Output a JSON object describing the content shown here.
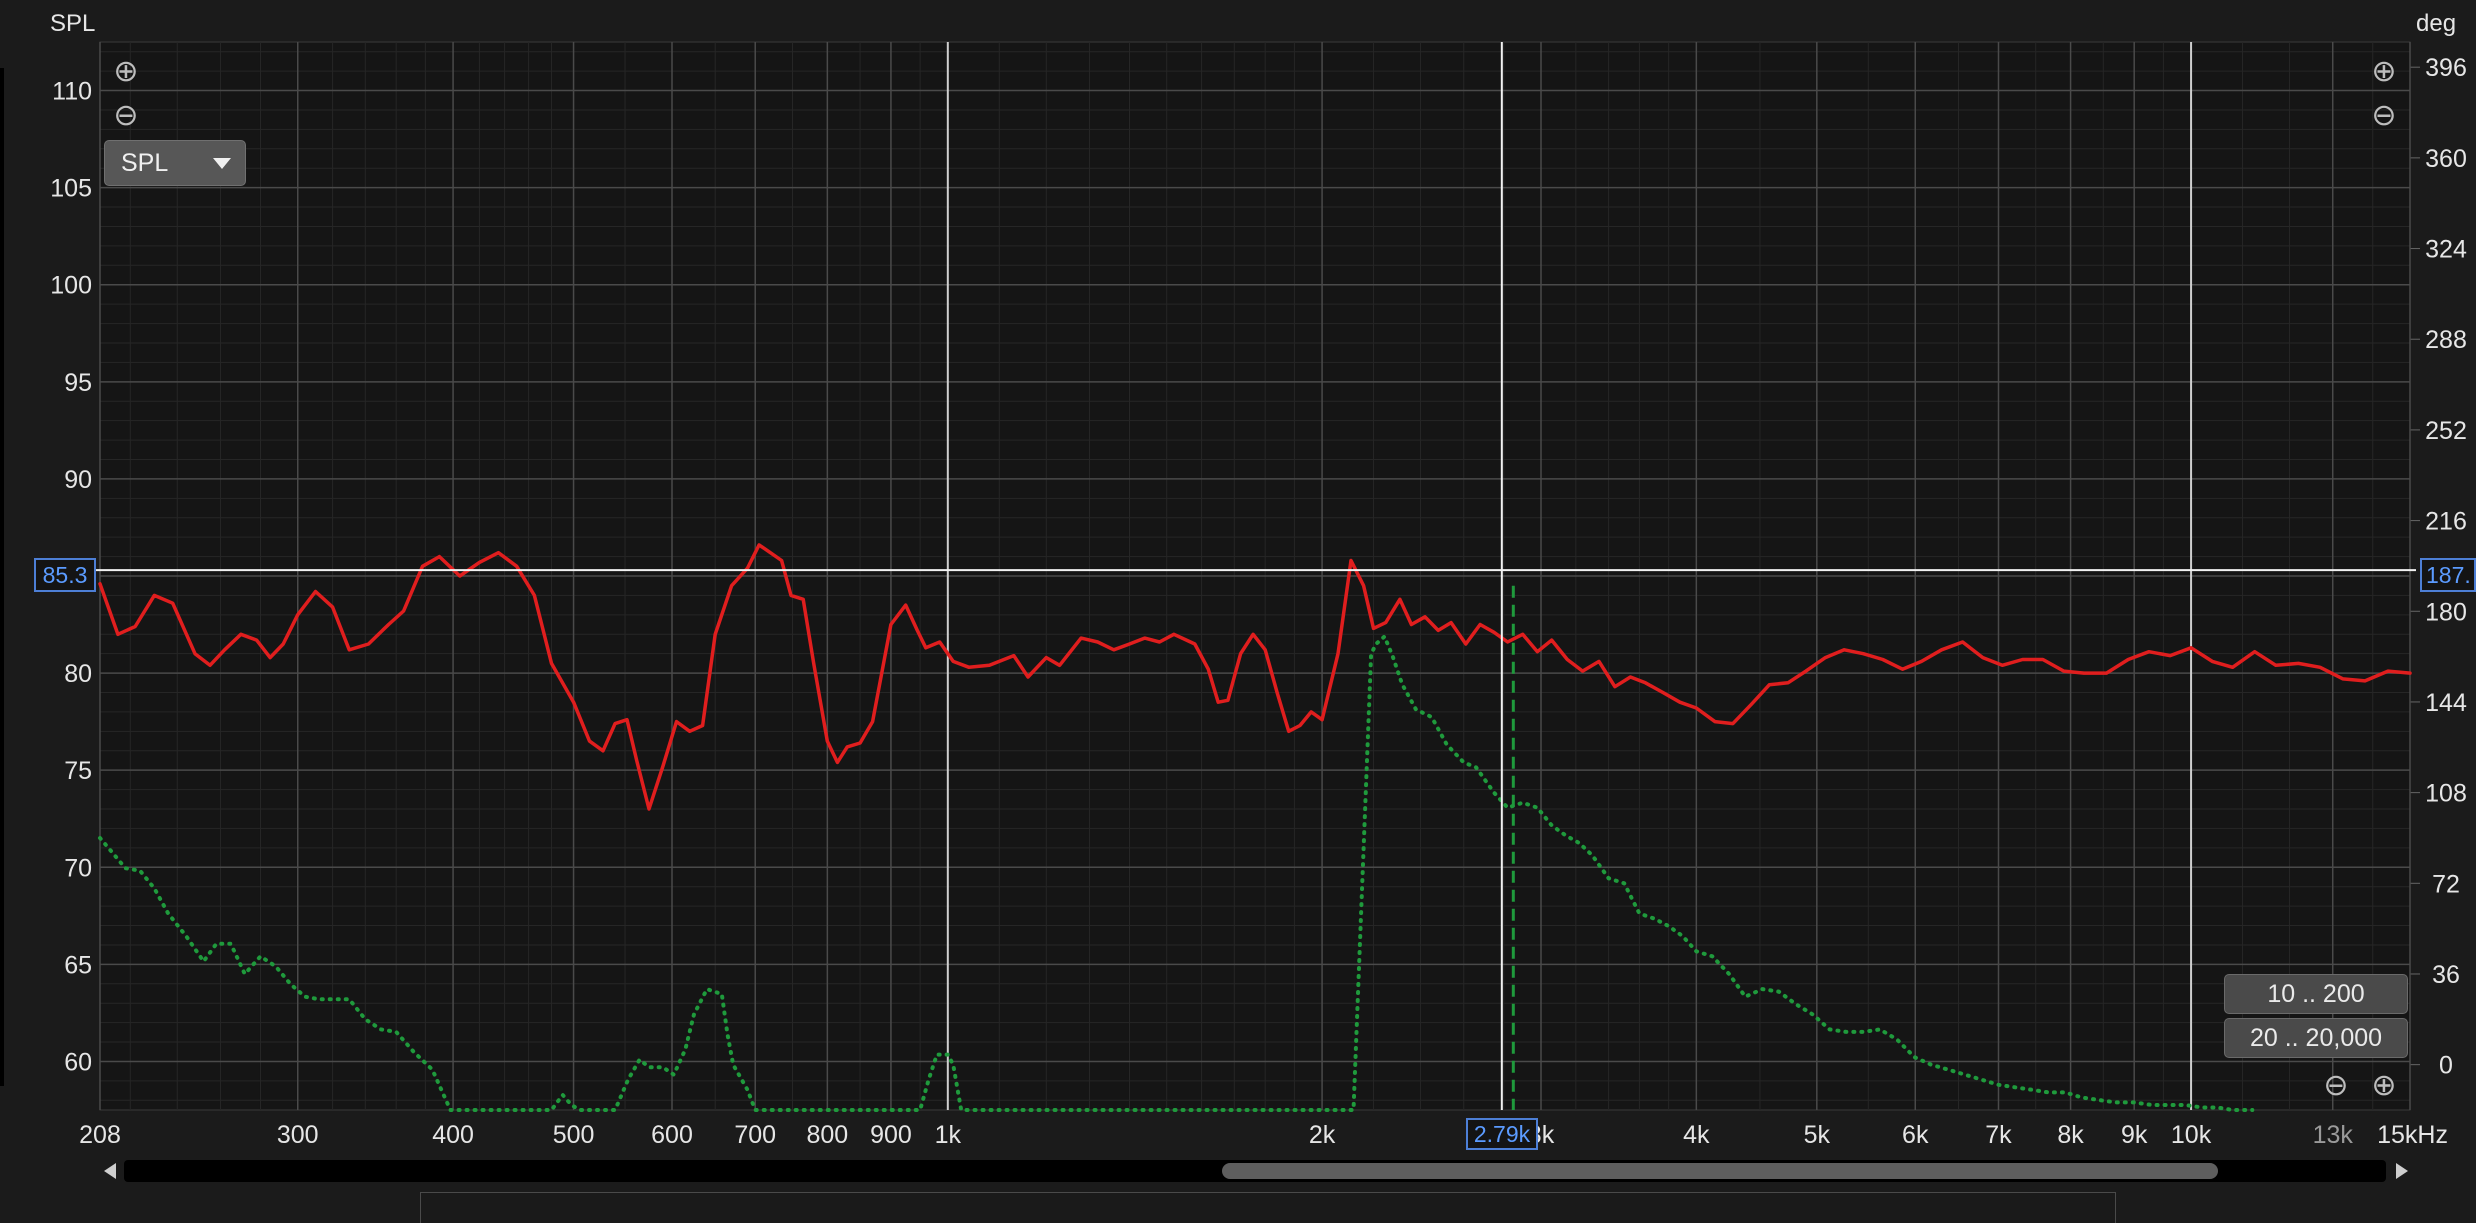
{
  "chart_data": {
    "type": "line",
    "xscale": "log",
    "xlim": [
      208,
      15000
    ],
    "ylim": [
      57.5,
      112.5
    ],
    "y2lim": [
      -18,
      406
    ],
    "ylabel": "SPL",
    "y2label": "deg",
    "yticks": [
      60,
      65,
      70,
      75,
      80,
      85,
      90,
      95,
      100,
      105,
      110
    ],
    "y2ticks": [
      0,
      36,
      72,
      108,
      144,
      180,
      216,
      252,
      288,
      324,
      360,
      396
    ],
    "xticks": [
      {
        "value": 208,
        "label": "208"
      },
      {
        "value": 300,
        "label": "300"
      },
      {
        "value": 400,
        "label": "400"
      },
      {
        "value": 500,
        "label": "500"
      },
      {
        "value": 600,
        "label": "600"
      },
      {
        "value": 700,
        "label": "700"
      },
      {
        "value": 800,
        "label": "800"
      },
      {
        "value": 900,
        "label": "900"
      },
      {
        "value": 1000,
        "label": "1k"
      },
      {
        "value": 2000,
        "label": "2k"
      },
      {
        "value": 3000,
        "label": "3k"
      },
      {
        "value": 4000,
        "label": "4k"
      },
      {
        "value": 5000,
        "label": "5k"
      },
      {
        "value": 6000,
        "label": "6k"
      },
      {
        "value": 7000,
        "label": "7k"
      },
      {
        "value": 8000,
        "label": "8k"
      },
      {
        "value": 9000,
        "label": "9k"
      },
      {
        "value": 10000,
        "label": "10k"
      },
      {
        "value": 13000,
        "label": "13k"
      },
      {
        "value": 15000,
        "label": "15kHz"
      }
    ],
    "grid": true,
    "series": [
      {
        "axis": "left",
        "color": "#e01e1e",
        "style": "solid",
        "points": [
          [
            208,
            84.6
          ],
          [
            215,
            82
          ],
          [
            222,
            82.4
          ],
          [
            230,
            84
          ],
          [
            238,
            83.6
          ],
          [
            248,
            81
          ],
          [
            255,
            80.4
          ],
          [
            262,
            81.2
          ],
          [
            270,
            82
          ],
          [
            278,
            81.7
          ],
          [
            285,
            80.8
          ],
          [
            292,
            81.5
          ],
          [
            300,
            83
          ],
          [
            310,
            84.2
          ],
          [
            320,
            83.4
          ],
          [
            330,
            81.2
          ],
          [
            342,
            81.5
          ],
          [
            355,
            82.5
          ],
          [
            365,
            83.2
          ],
          [
            378,
            85.5
          ],
          [
            390,
            86
          ],
          [
            405,
            85
          ],
          [
            420,
            85.7
          ],
          [
            435,
            86.2
          ],
          [
            450,
            85.5
          ],
          [
            465,
            84
          ],
          [
            480,
            80.5
          ],
          [
            500,
            78.5
          ],
          [
            515,
            76.5
          ],
          [
            528,
            76
          ],
          [
            540,
            77.4
          ],
          [
            552,
            77.6
          ],
          [
            562,
            75.5
          ],
          [
            575,
            73
          ],
          [
            590,
            75.2
          ],
          [
            605,
            77.5
          ],
          [
            620,
            77
          ],
          [
            635,
            77.3
          ],
          [
            650,
            82
          ],
          [
            670,
            84.5
          ],
          [
            690,
            85.4
          ],
          [
            705,
            86.6
          ],
          [
            720,
            86.2
          ],
          [
            735,
            85.8
          ],
          [
            748,
            84
          ],
          [
            765,
            83.8
          ],
          [
            780,
            80.5
          ],
          [
            800,
            76.5
          ],
          [
            815,
            75.4
          ],
          [
            830,
            76.2
          ],
          [
            850,
            76.4
          ],
          [
            870,
            77.5
          ],
          [
            900,
            82.5
          ],
          [
            925,
            83.5
          ],
          [
            945,
            82.2
          ],
          [
            960,
            81.3
          ],
          [
            985,
            81.6
          ],
          [
            1010,
            80.6
          ],
          [
            1040,
            80.3
          ],
          [
            1080,
            80.4
          ],
          [
            1130,
            80.9
          ],
          [
            1160,
            79.8
          ],
          [
            1200,
            80.8
          ],
          [
            1230,
            80.4
          ],
          [
            1280,
            81.8
          ],
          [
            1320,
            81.6
          ],
          [
            1360,
            81.2
          ],
          [
            1400,
            81.5
          ],
          [
            1440,
            81.8
          ],
          [
            1480,
            81.6
          ],
          [
            1520,
            82
          ],
          [
            1580,
            81.5
          ],
          [
            1620,
            80.2
          ],
          [
            1650,
            78.5
          ],
          [
            1680,
            78.6
          ],
          [
            1720,
            81
          ],
          [
            1760,
            82
          ],
          [
            1800,
            81.2
          ],
          [
            1840,
            79
          ],
          [
            1880,
            77
          ],
          [
            1920,
            77.3
          ],
          [
            1960,
            78
          ],
          [
            2000,
            77.6
          ],
          [
            2060,
            81
          ],
          [
            2110,
            85.8
          ],
          [
            2160,
            84.5
          ],
          [
            2200,
            82.3
          ],
          [
            2250,
            82.6
          ],
          [
            2310,
            83.8
          ],
          [
            2360,
            82.5
          ],
          [
            2420,
            82.9
          ],
          [
            2480,
            82.2
          ],
          [
            2540,
            82.6
          ],
          [
            2610,
            81.5
          ],
          [
            2680,
            82.5
          ],
          [
            2750,
            82.1
          ],
          [
            2820,
            81.6
          ],
          [
            2900,
            82
          ],
          [
            2980,
            81.1
          ],
          [
            3060,
            81.7
          ],
          [
            3150,
            80.7
          ],
          [
            3240,
            80.1
          ],
          [
            3340,
            80.6
          ],
          [
            3440,
            79.3
          ],
          [
            3540,
            79.8
          ],
          [
            3640,
            79.5
          ],
          [
            3760,
            79
          ],
          [
            3880,
            78.5
          ],
          [
            4000,
            78.2
          ],
          [
            4140,
            77.5
          ],
          [
            4280,
            77.4
          ],
          [
            4430,
            78.4
          ],
          [
            4580,
            79.4
          ],
          [
            4740,
            79.5
          ],
          [
            4900,
            80.1
          ],
          [
            5080,
            80.8
          ],
          [
            5260,
            81.2
          ],
          [
            5450,
            81
          ],
          [
            5650,
            80.7
          ],
          [
            5860,
            80.2
          ],
          [
            6070,
            80.6
          ],
          [
            6300,
            81.2
          ],
          [
            6550,
            81.6
          ],
          [
            6800,
            80.8
          ],
          [
            7050,
            80.4
          ],
          [
            7320,
            80.7
          ],
          [
            7600,
            80.7
          ],
          [
            7900,
            80.1
          ],
          [
            8200,
            80
          ],
          [
            8550,
            80
          ],
          [
            8900,
            80.7
          ],
          [
            9250,
            81.1
          ],
          [
            9620,
            80.9
          ],
          [
            10000,
            81.3
          ],
          [
            10400,
            80.6
          ],
          [
            10800,
            80.3
          ],
          [
            11250,
            81.1
          ],
          [
            11700,
            80.4
          ],
          [
            12200,
            80.5
          ],
          [
            12700,
            80.3
          ],
          [
            13250,
            79.7
          ],
          [
            13800,
            79.6
          ],
          [
            14400,
            80.1
          ],
          [
            15000,
            80
          ]
        ]
      },
      {
        "axis": "right",
        "color": "#1f9a3c",
        "style": "dotted",
        "points": [
          [
            208,
            90
          ],
          [
            213,
            84
          ],
          [
            218,
            78
          ],
          [
            224,
            77
          ],
          [
            230,
            70
          ],
          [
            236,
            60
          ],
          [
            244,
            51
          ],
          [
            252,
            41
          ],
          [
            258,
            48
          ],
          [
            265,
            48
          ],
          [
            272,
            36
          ],
          [
            280,
            43
          ],
          [
            288,
            39
          ],
          [
            296,
            32
          ],
          [
            304,
            27
          ],
          [
            312,
            26
          ],
          [
            320,
            26
          ],
          [
            330,
            26
          ],
          [
            340,
            18
          ],
          [
            350,
            14
          ],
          [
            360,
            13
          ],
          [
            372,
            5
          ],
          [
            385,
            -2
          ],
          [
            398,
            -18
          ],
          [
            480,
            -18
          ],
          [
            490,
            -12
          ],
          [
            498,
            -16
          ],
          [
            506,
            -18
          ],
          [
            540,
            -18
          ],
          [
            553,
            -6
          ],
          [
            565,
            2
          ],
          [
            575,
            -1
          ],
          [
            590,
            -1
          ],
          [
            602,
            -4
          ],
          [
            615,
            6
          ],
          [
            625,
            20
          ],
          [
            640,
            30
          ],
          [
            658,
            28
          ],
          [
            665,
            12
          ],
          [
            672,
            0
          ],
          [
            690,
            -10
          ],
          [
            700,
            -18
          ],
          [
            950,
            -18
          ],
          [
            965,
            -6
          ],
          [
            980,
            4
          ],
          [
            1000,
            4
          ],
          [
            1010,
            0
          ],
          [
            1025,
            -18
          ],
          [
            1040,
            -18
          ],
          [
            1060,
            -18
          ],
          [
            2120,
            -18
          ],
          [
            2190,
            163
          ],
          [
            2210,
            167
          ],
          [
            2245,
            170
          ],
          [
            2280,
            162
          ],
          [
            2320,
            151
          ],
          [
            2380,
            141
          ],
          [
            2450,
            138
          ],
          [
            2520,
            127
          ],
          [
            2600,
            120
          ],
          [
            2660,
            118
          ],
          [
            2750,
            108
          ],
          [
            2820,
            102
          ],
          [
            2900,
            104
          ],
          [
            2980,
            102
          ],
          [
            3060,
            95
          ],
          [
            3140,
            91
          ],
          [
            3220,
            88
          ],
          [
            3300,
            83
          ],
          [
            3400,
            74
          ],
          [
            3500,
            72
          ],
          [
            3600,
            60
          ],
          [
            3700,
            58
          ],
          [
            3800,
            55
          ],
          [
            3900,
            51
          ],
          [
            4000,
            45
          ],
          [
            4120,
            43
          ],
          [
            4250,
            36
          ],
          [
            4380,
            27
          ],
          [
            4520,
            30
          ],
          [
            4660,
            29
          ],
          [
            4810,
            24
          ],
          [
            4960,
            20
          ],
          [
            5120,
            14
          ],
          [
            5280,
            13
          ],
          [
            5450,
            13
          ],
          [
            5620,
            14
          ],
          [
            5800,
            10
          ],
          [
            5990,
            3
          ],
          [
            6180,
            0
          ],
          [
            6380,
            -2
          ],
          [
            6580,
            -4
          ],
          [
            6790,
            -6
          ],
          [
            7000,
            -8
          ],
          [
            7220,
            -9
          ],
          [
            7450,
            -10
          ],
          [
            7680,
            -11
          ],
          [
            7920,
            -11
          ],
          [
            8160,
            -13
          ],
          [
            8420,
            -14
          ],
          [
            8700,
            -15
          ],
          [
            9000,
            -15
          ],
          [
            9300,
            -16
          ],
          [
            9600,
            -16
          ],
          [
            9900,
            -16
          ],
          [
            10200,
            -17
          ],
          [
            10500,
            -17
          ],
          [
            10800,
            -18
          ],
          [
            11200,
            -18
          ]
        ]
      }
    ],
    "cursor": {
      "x": 2790,
      "y": 85.3,
      "x_label": "2.79k",
      "y_label": "85.3",
      "y2_label": "187."
    }
  },
  "ui": {
    "ylabel_text": "SPL",
    "y2label_text": "deg",
    "dropdown_label": "SPL",
    "range1_label": "10 .. 200",
    "range2_label": "20 .. 20,000",
    "icons": {
      "zoom_in": "zoom-in-icon",
      "zoom_out": "zoom-out-icon",
      "dropdown": "chevron-down-icon",
      "scroll_left": "arrow-left-icon",
      "scroll_right": "arrow-right-icon"
    },
    "colors": {
      "background": "#1b1b1b",
      "plot": "#151515",
      "accent": "#5b9bff",
      "spl": "#e01e1e",
      "phase": "#1f9a3c"
    }
  }
}
